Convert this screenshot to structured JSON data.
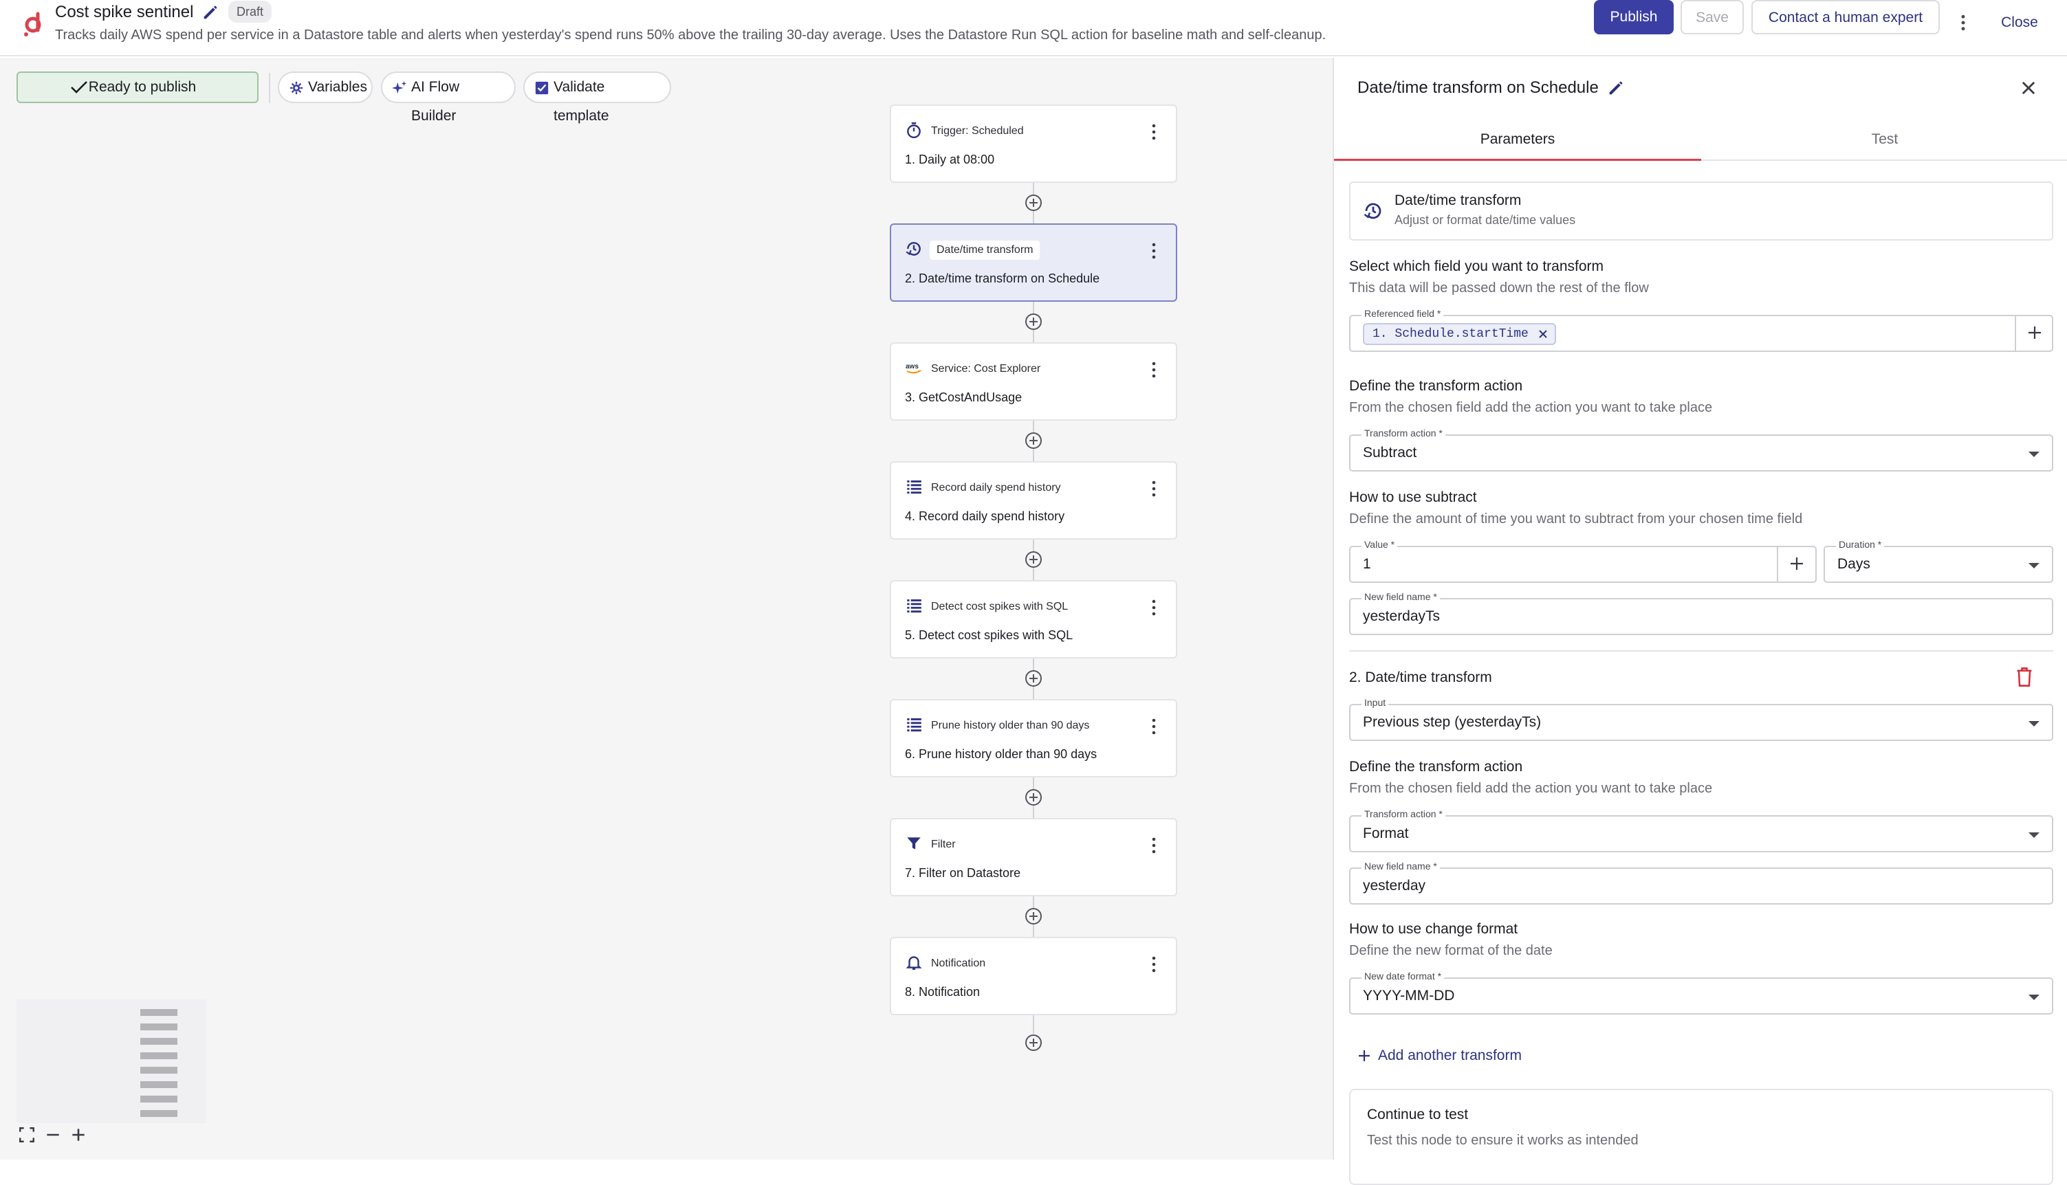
{
  "header": {
    "title": "Cost spike sentinel",
    "status": "Draft",
    "description": "Tracks daily AWS spend per service in a Datastore table and alerts when yesterday's spend runs 50% above the trailing 30-day average. Uses the Datastore Run SQL action for baseline math and self-cleanup.",
    "publish_label": "Publish",
    "save_label": "Save",
    "expert_label": "Contact a human expert",
    "close_label": "Close"
  },
  "toolbar": {
    "ready_label": "Ready to publish",
    "variables_label": "Variables",
    "ai_label": "AI Flow Builder",
    "validate_label": "Validate template"
  },
  "nodes": [
    {
      "label": "Trigger: Scheduled",
      "name": "1. Daily at 08:00",
      "icon": "stopwatch-icon"
    },
    {
      "label": "Date/time transform",
      "name": "2. Date/time transform on Schedule",
      "icon": "clock-transform-icon"
    },
    {
      "label": "Service: Cost Explorer",
      "name": "3. GetCostAndUsage",
      "icon": "aws-icon"
    },
    {
      "label": "Record daily spend history",
      "name": "4. Record daily spend history",
      "icon": "list-icon"
    },
    {
      "label": "Detect cost spikes with SQL",
      "name": "5. Detect cost spikes with SQL",
      "icon": "list-icon"
    },
    {
      "label": "Prune history older than 90 days",
      "name": "6. Prune history older than 90 days",
      "icon": "list-icon"
    },
    {
      "label": "Filter",
      "name": "7. Filter on Datastore",
      "icon": "filter-icon"
    },
    {
      "label": "Notification",
      "name": "8. Notification",
      "icon": "bell-icon"
    }
  ],
  "panel": {
    "title": "Date/time transform on Schedule",
    "tabs": [
      "Parameters",
      "Test"
    ],
    "card_title": "Date/time transform",
    "card_subtitle": "Adjust or format date/time values",
    "select_heading": "Select which field you want to transform",
    "select_sub": "This data will be passed down the rest of the flow",
    "ref_label": "Referenced field *",
    "ref_chip": "1. Schedule.startTime",
    "t1": {
      "define_heading": "Define the transform action",
      "define_sub": "From the chosen field add the action you want to take place",
      "action_label": "Transform action *",
      "action_value": "Subtract",
      "how_heading": "How to use subtract",
      "how_sub": "Define the amount of time you want to subtract from your chosen time field",
      "value_label": "Value *",
      "value": "1",
      "duration_label": "Duration *",
      "duration_value": "Days",
      "newname_label": "New field name *",
      "newname_value": "yesterdayTs"
    },
    "t2": {
      "heading": "2. Date/time transform",
      "input_label": "Input",
      "input_value": "Previous step (yesterdayTs)",
      "define_heading": "Define the transform action",
      "define_sub": "From the chosen field add the action you want to take place",
      "action_label": "Transform action *",
      "action_value": "Format",
      "newname_label": "New field name *",
      "newname_value": "yesterday",
      "how_heading": "How to use change format",
      "how_sub": "Define the new format of the date",
      "format_label": "New date format *",
      "format_value": "YYYY-MM-DD"
    },
    "add_another": "Add another transform",
    "test_title": "Continue to test",
    "test_sub": "Test this node to ensure it works as intended"
  }
}
